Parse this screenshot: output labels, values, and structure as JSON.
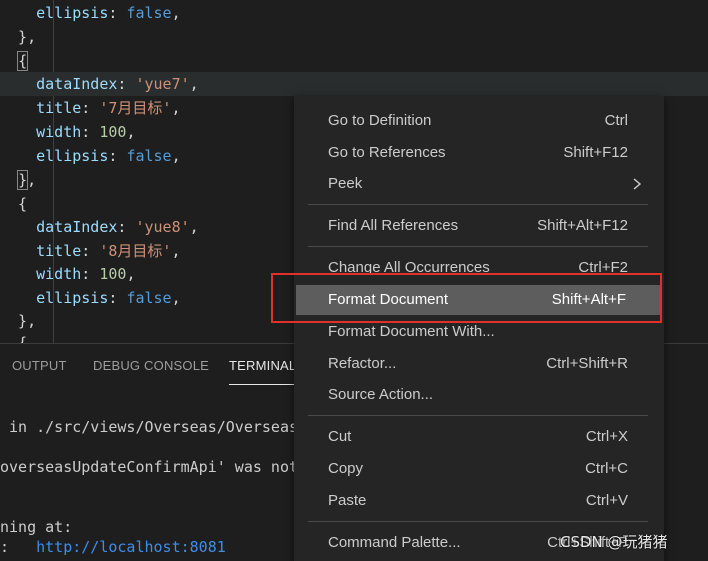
{
  "editor": {
    "lines": [
      {
        "indent": "    ",
        "key": "ellipsis",
        "value": "false",
        "kind": "bool"
      },
      {
        "text": "  },",
        "kind": "plain"
      },
      {
        "text": "  {",
        "kind": "brace"
      },
      {
        "indent": "    ",
        "key": "dataIndex",
        "value": "'yue7'",
        "kind": "str"
      },
      {
        "indent": "    ",
        "key": "title",
        "value": "'7月目标'",
        "kind": "str"
      },
      {
        "indent": "    ",
        "key": "width",
        "value": "100",
        "kind": "num"
      },
      {
        "indent": "    ",
        "key": "ellipsis",
        "value": "false",
        "kind": "bool"
      },
      {
        "text": "  },",
        "kind": "brace-close"
      },
      {
        "text": "  {",
        "kind": "plain"
      },
      {
        "indent": "    ",
        "key": "dataIndex",
        "value": "'yue8'",
        "kind": "str"
      },
      {
        "indent": "    ",
        "key": "title",
        "value": "'8月目标'",
        "kind": "str"
      },
      {
        "indent": "    ",
        "key": "width",
        "value": "100",
        "kind": "num"
      },
      {
        "indent": "    ",
        "key": "ellipsis",
        "value": "false",
        "kind": "bool"
      },
      {
        "text": "  },",
        "kind": "plain"
      },
      {
        "text": "  {",
        "kind": "plain"
      }
    ]
  },
  "panel": {
    "tabs": {
      "output": "OUTPUT",
      "debug_console": "DEBUG CONSOLE",
      "terminal": "TERMINAL"
    },
    "terminal_lines": {
      "line1": " in ./src/views/Overseas/Overseas",
      "line2": "overseasUpdateConfirmApi' was not",
      "line3": "ning at:",
      "line4_prefix": ":   ",
      "line4_url": "http://localhost:",
      "line4_port": "8081"
    }
  },
  "context_menu": {
    "items": {
      "go_to_definition": {
        "label": "Go to Definition",
        "shortcut": "Ctrl"
      },
      "go_to_references": {
        "label": "Go to References",
        "shortcut": "Shift+F12"
      },
      "peek": {
        "label": "Peek",
        "shortcut": ""
      },
      "find_all_references": {
        "label": "Find All References",
        "shortcut": "Shift+Alt+F12"
      },
      "change_all_occurrences": {
        "label": "Change All Occurrences",
        "shortcut": "Ctrl+F2"
      },
      "format_document": {
        "label": "Format Document",
        "shortcut": "Shift+Alt+F"
      },
      "format_document_with": {
        "label": "Format Document With...",
        "shortcut": ""
      },
      "refactor": {
        "label": "Refactor...",
        "shortcut": "Ctrl+Shift+R"
      },
      "source_action": {
        "label": "Source Action...",
        "shortcut": ""
      },
      "cut": {
        "label": "Cut",
        "shortcut": "Ctrl+X"
      },
      "copy": {
        "label": "Copy",
        "shortcut": "Ctrl+C"
      },
      "paste": {
        "label": "Paste",
        "shortcut": "Ctrl+V"
      },
      "command_palette": {
        "label": "Command Palette...",
        "shortcut": "Ctrl+Shift+P"
      }
    },
    "selected": "format_document",
    "highlight_color": "#e0302a"
  },
  "watermark": "CSDN @玩猪猪"
}
